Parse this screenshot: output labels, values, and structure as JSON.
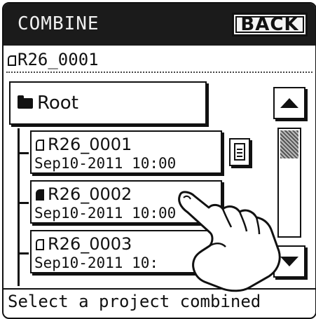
{
  "header": {
    "title": "COMBINE",
    "back_label": "BACK"
  },
  "current_path": "R26_0001",
  "tree": {
    "root_label": "Root",
    "items": [
      {
        "name": "R26_0001",
        "date": "Sep10-2011 10:00",
        "icon": "document-icon"
      },
      {
        "name": "R26_0002",
        "date": "Sep10-2011 10:00",
        "icon": "combined-document-icon"
      },
      {
        "name": "R26_0003",
        "date": "Sep10-2011 10:",
        "icon": "document-icon"
      }
    ]
  },
  "status": "Select a project combined"
}
